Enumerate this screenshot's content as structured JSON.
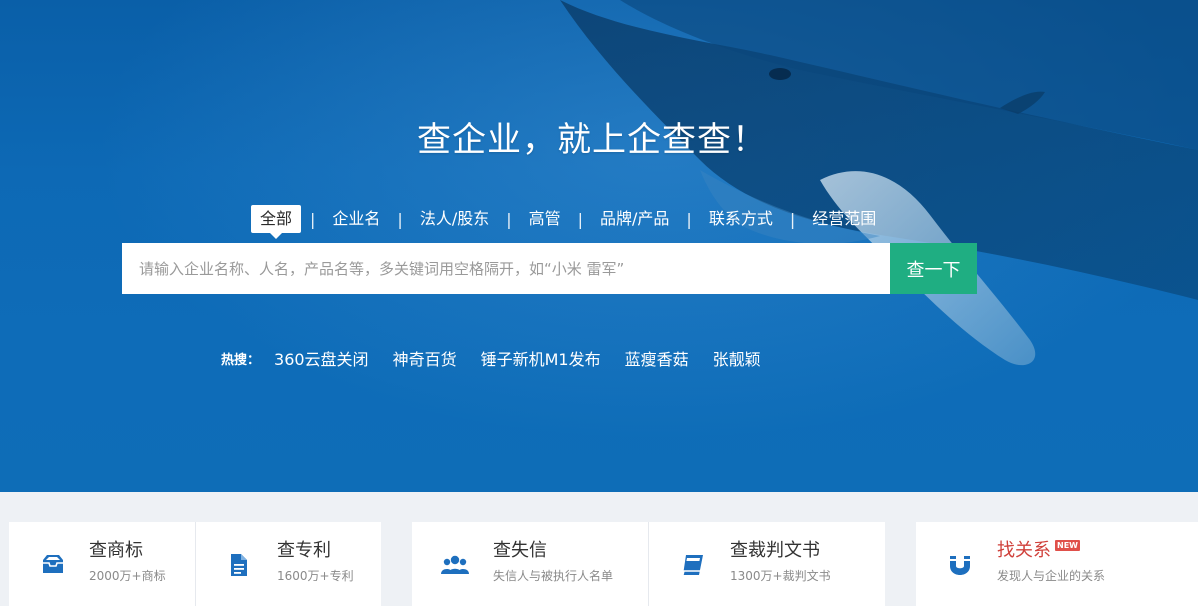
{
  "hero": {
    "slogan": "查企业，就上企查查！",
    "tabs": [
      {
        "label": "全部",
        "active": true
      },
      {
        "label": "企业名",
        "active": false
      },
      {
        "label": "法人/股东",
        "active": false
      },
      {
        "label": "高管",
        "active": false
      },
      {
        "label": "品牌/产品",
        "active": false
      },
      {
        "label": "联系方式",
        "active": false
      },
      {
        "label": "经营范围",
        "active": false
      }
    ],
    "tab_separator": "|",
    "search": {
      "value": "",
      "placeholder": "请输入企业名称、人名，产品名等，多关键词用空格隔开，如“小米 雷军”",
      "button_label": "查一下"
    },
    "hot_search": {
      "label": "热搜：",
      "items": [
        "360云盘关闭",
        "神奇百货",
        "锤子新机M1发布",
        "蓝瘦香菇",
        "张靓颖"
      ]
    }
  },
  "cards": {
    "trademark": {
      "title": "查商标",
      "sub": "2000万+商标",
      "icon": "inbox-icon"
    },
    "patent": {
      "title": "查专利",
      "sub": "1600万+专利",
      "icon": "document-icon"
    },
    "dishonest": {
      "title": "查失信",
      "sub": "失信人与被执行人名单",
      "icon": "users-icon"
    },
    "judgment": {
      "title": "查裁判文书",
      "sub": "1300万+裁判文书",
      "icon": "book-icon"
    },
    "relation": {
      "title": "找关系",
      "badge": "NEW",
      "sub": "发现人与企业的关系",
      "icon": "magnet-icon"
    }
  },
  "colors": {
    "hero_blue": "#0d69b5",
    "search_button": "#1fae82",
    "icon_blue": "#1e6fbe",
    "relation_red": "#d0413b"
  }
}
